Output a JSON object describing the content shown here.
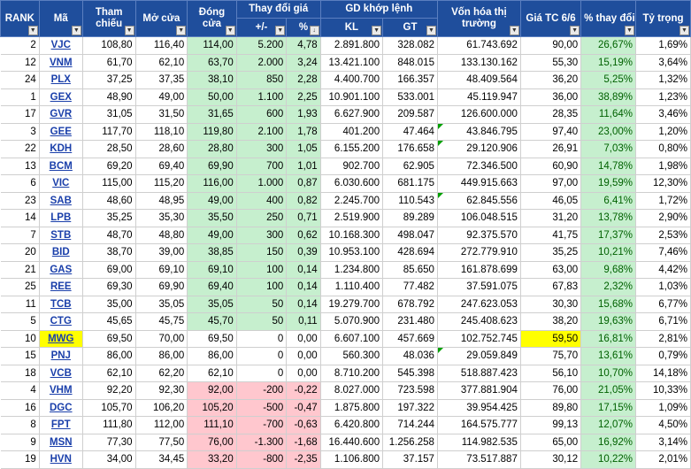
{
  "headers": {
    "rank": "RANK",
    "ma": "Mã",
    "tham_chieu": "Tham chiếu",
    "mo_cua": "Mở cửa",
    "dong_cua": "Đóng cửa",
    "thay_doi_gia": "Thay đổi giá",
    "chg_abs": "+/-",
    "chg_pct": "%",
    "gd_khop_lenh": "GD khớp lệnh",
    "kl": "KL",
    "gt": "GT",
    "von_hoa": "Vốn hóa thị trường",
    "gia_tc": "Giá TC 6/6",
    "pct_thay_doi": "% thay đổi",
    "ty_trong": "Tỷ trọng"
  },
  "rows": [
    {
      "rank": "2",
      "sym": "VJC",
      "ref": "108,80",
      "open": "116,40",
      "close": "114,00",
      "chg": "5.200",
      "pct": "4,78",
      "kl": "2.891.800",
      "gt": "328.082",
      "cap": "61.743.692",
      "tc": "90,00",
      "pchg": "26,67%",
      "w": "1,69%",
      "cls": "g"
    },
    {
      "rank": "12",
      "sym": "VNM",
      "ref": "61,70",
      "open": "62,10",
      "close": "63,70",
      "chg": "2.000",
      "pct": "3,24",
      "kl": "13.421.100",
      "gt": "848.015",
      "cap": "133.130.162",
      "tc": "55,30",
      "pchg": "15,19%",
      "w": "3,64%",
      "cls": "g"
    },
    {
      "rank": "24",
      "sym": "PLX",
      "ref": "37,25",
      "open": "37,35",
      "close": "38,10",
      "chg": "850",
      "pct": "2,28",
      "kl": "4.400.700",
      "gt": "166.357",
      "cap": "48.409.564",
      "tc": "36,20",
      "pchg": "5,25%",
      "w": "1,32%",
      "cls": "g"
    },
    {
      "rank": "1",
      "sym": "GEX",
      "ref": "48,90",
      "open": "49,00",
      "close": "50,00",
      "chg": "1.100",
      "pct": "2,25",
      "kl": "10.901.100",
      "gt": "533.001",
      "cap": "45.119.947",
      "tc": "36,00",
      "pchg": "38,89%",
      "w": "1,23%",
      "cls": "g"
    },
    {
      "rank": "17",
      "sym": "GVR",
      "ref": "31,05",
      "open": "31,50",
      "close": "31,65",
      "chg": "600",
      "pct": "1,93",
      "kl": "6.627.900",
      "gt": "209.587",
      "cap": "126.600.000",
      "tc": "28,35",
      "pchg": "11,64%",
      "w": "3,46%",
      "cls": "g"
    },
    {
      "rank": "3",
      "sym": "GEE",
      "ref": "117,70",
      "open": "118,10",
      "close": "119,80",
      "chg": "2.100",
      "pct": "1,78",
      "kl": "401.200",
      "gt": "47.464",
      "cap": "43.846.795",
      "tc": "97,40",
      "pchg": "23,00%",
      "w": "1,20%",
      "cls": "g"
    },
    {
      "rank": "22",
      "sym": "KDH",
      "ref": "28,50",
      "open": "28,60",
      "close": "28,80",
      "chg": "300",
      "pct": "1,05",
      "kl": "6.155.200",
      "gt": "176.658",
      "cap": "29.120.906",
      "tc": "26,91",
      "pchg": "7,03%",
      "w": "0,80%",
      "cls": "g"
    },
    {
      "rank": "13",
      "sym": "BCM",
      "ref": "69,20",
      "open": "69,40",
      "close": "69,90",
      "chg": "700",
      "pct": "1,01",
      "kl": "902.700",
      "gt": "62.905",
      "cap": "72.346.500",
      "tc": "60,90",
      "pchg": "14,78%",
      "w": "1,98%",
      "cls": "g"
    },
    {
      "rank": "6",
      "sym": "VIC",
      "ref": "115,00",
      "open": "115,20",
      "close": "116,00",
      "chg": "1.000",
      "pct": "0,87",
      "kl": "6.030.600",
      "gt": "681.175",
      "cap": "449.915.663",
      "tc": "97,00",
      "pchg": "19,59%",
      "w": "12,30%",
      "cls": "g"
    },
    {
      "rank": "23",
      "sym": "SAB",
      "ref": "48,60",
      "open": "48,95",
      "close": "49,00",
      "chg": "400",
      "pct": "0,82",
      "kl": "2.245.700",
      "gt": "110.543",
      "cap": "62.845.556",
      "tc": "46,05",
      "pchg": "6,41%",
      "w": "1,72%",
      "cls": "g"
    },
    {
      "rank": "14",
      "sym": "LPB",
      "ref": "35,25",
      "open": "35,30",
      "close": "35,50",
      "chg": "250",
      "pct": "0,71",
      "kl": "2.519.900",
      "gt": "89.289",
      "cap": "106.048.515",
      "tc": "31,20",
      "pchg": "13,78%",
      "w": "2,90%",
      "cls": "g"
    },
    {
      "rank": "7",
      "sym": "STB",
      "ref": "48,70",
      "open": "48,80",
      "close": "49,00",
      "chg": "300",
      "pct": "0,62",
      "kl": "10.168.300",
      "gt": "498.047",
      "cap": "92.375.570",
      "tc": "41,75",
      "pchg": "17,37%",
      "w": "2,53%",
      "cls": "g"
    },
    {
      "rank": "20",
      "sym": "BID",
      "ref": "38,70",
      "open": "39,00",
      "close": "38,85",
      "chg": "150",
      "pct": "0,39",
      "kl": "10.953.100",
      "gt": "428.694",
      "cap": "272.779.910",
      "tc": "35,25",
      "pchg": "10,21%",
      "w": "7,46%",
      "cls": "g"
    },
    {
      "rank": "21",
      "sym": "GAS",
      "ref": "69,00",
      "open": "69,10",
      "close": "69,10",
      "chg": "100",
      "pct": "0,14",
      "kl": "1.234.800",
      "gt": "85.650",
      "cap": "161.878.699",
      "tc": "63,00",
      "pchg": "9,68%",
      "w": "4,42%",
      "cls": "g"
    },
    {
      "rank": "25",
      "sym": "REE",
      "ref": "69,30",
      "open": "69,90",
      "close": "69,40",
      "chg": "100",
      "pct": "0,14",
      "kl": "1.110.400",
      "gt": "77.482",
      "cap": "37.591.075",
      "tc": "67,83",
      "pchg": "2,32%",
      "w": "1,03%",
      "cls": "g"
    },
    {
      "rank": "11",
      "sym": "TCB",
      "ref": "35,00",
      "open": "35,05",
      "close": "35,05",
      "chg": "50",
      "pct": "0,14",
      "kl": "19.279.700",
      "gt": "678.792",
      "cap": "247.623.053",
      "tc": "30,30",
      "pchg": "15,68%",
      "w": "6,77%",
      "cls": "g"
    },
    {
      "rank": "5",
      "sym": "CTG",
      "ref": "45,65",
      "open": "45,75",
      "close": "45,70",
      "chg": "50",
      "pct": "0,11",
      "kl": "5.070.900",
      "gt": "231.480",
      "cap": "245.408.623",
      "tc": "38,20",
      "pchg": "19,63%",
      "w": "6,71%",
      "cls": "g"
    },
    {
      "rank": "10",
      "sym": "MWG",
      "ref": "69,50",
      "open": "70,00",
      "close": "69,50",
      "chg": "0",
      "pct": "0,00",
      "kl": "6.607.100",
      "gt": "457.669",
      "cap": "102.752.745",
      "tc": "59,50",
      "pchg": "16,81%",
      "w": "2,81%",
      "cls": "n"
    },
    {
      "rank": "15",
      "sym": "PNJ",
      "ref": "86,00",
      "open": "86,00",
      "close": "86,00",
      "chg": "0",
      "pct": "0,00",
      "kl": "560.300",
      "gt": "48.036",
      "cap": "29.059.849",
      "tc": "75,70",
      "pchg": "13,61%",
      "w": "0,79%",
      "cls": "n"
    },
    {
      "rank": "18",
      "sym": "VCB",
      "ref": "62,10",
      "open": "62,20",
      "close": "62,10",
      "chg": "0",
      "pct": "0,00",
      "kl": "8.710.200",
      "gt": "545.398",
      "cap": "518.887.423",
      "tc": "56,10",
      "pchg": "10,70%",
      "w": "14,18%",
      "cls": "n"
    },
    {
      "rank": "4",
      "sym": "VHM",
      "ref": "92,20",
      "open": "92,30",
      "close": "92,00",
      "chg": "-200",
      "pct": "-0,22",
      "kl": "8.027.000",
      "gt": "723.598",
      "cap": "377.881.904",
      "tc": "76,00",
      "pchg": "21,05%",
      "w": "10,33%",
      "cls": "r"
    },
    {
      "rank": "16",
      "sym": "DGC",
      "ref": "105,70",
      "open": "106,20",
      "close": "105,20",
      "chg": "-500",
      "pct": "-0,47",
      "kl": "1.875.800",
      "gt": "197.322",
      "cap": "39.954.425",
      "tc": "89,80",
      "pchg": "17,15%",
      "w": "1,09%",
      "cls": "r"
    },
    {
      "rank": "8",
      "sym": "FPT",
      "ref": "111,80",
      "open": "112,00",
      "close": "111,10",
      "chg": "-700",
      "pct": "-0,63",
      "kl": "6.420.800",
      "gt": "714.244",
      "cap": "164.575.777",
      "tc": "99,13",
      "pchg": "12,07%",
      "w": "4,50%",
      "cls": "r"
    },
    {
      "rank": "9",
      "sym": "MSN",
      "ref": "77,30",
      "open": "77,50",
      "close": "76,00",
      "chg": "-1.300",
      "pct": "-1,68",
      "kl": "16.440.600",
      "gt": "1.256.258",
      "cap": "114.982.535",
      "tc": "65,00",
      "pchg": "16,92%",
      "w": "3,14%",
      "cls": "r"
    },
    {
      "rank": "19",
      "sym": "HVN",
      "ref": "34,00",
      "open": "34,45",
      "close": "33,20",
      "chg": "-800",
      "pct": "-2,35",
      "kl": "1.106.800",
      "gt": "37.157",
      "cap": "73.517.887",
      "tc": "30,12",
      "pchg": "10,22%",
      "w": "2,01%",
      "cls": "r"
    }
  ],
  "highlight": {
    "symbol": "MWG",
    "tc": "59,50",
    "color": "#ffff00"
  },
  "colors": {
    "header_bg": "#1f4e9c",
    "up_fill": "#c6efce",
    "down_fill": "#ffc7ce",
    "pct_text": "#006100",
    "symbol_link": "#1a3faa"
  }
}
